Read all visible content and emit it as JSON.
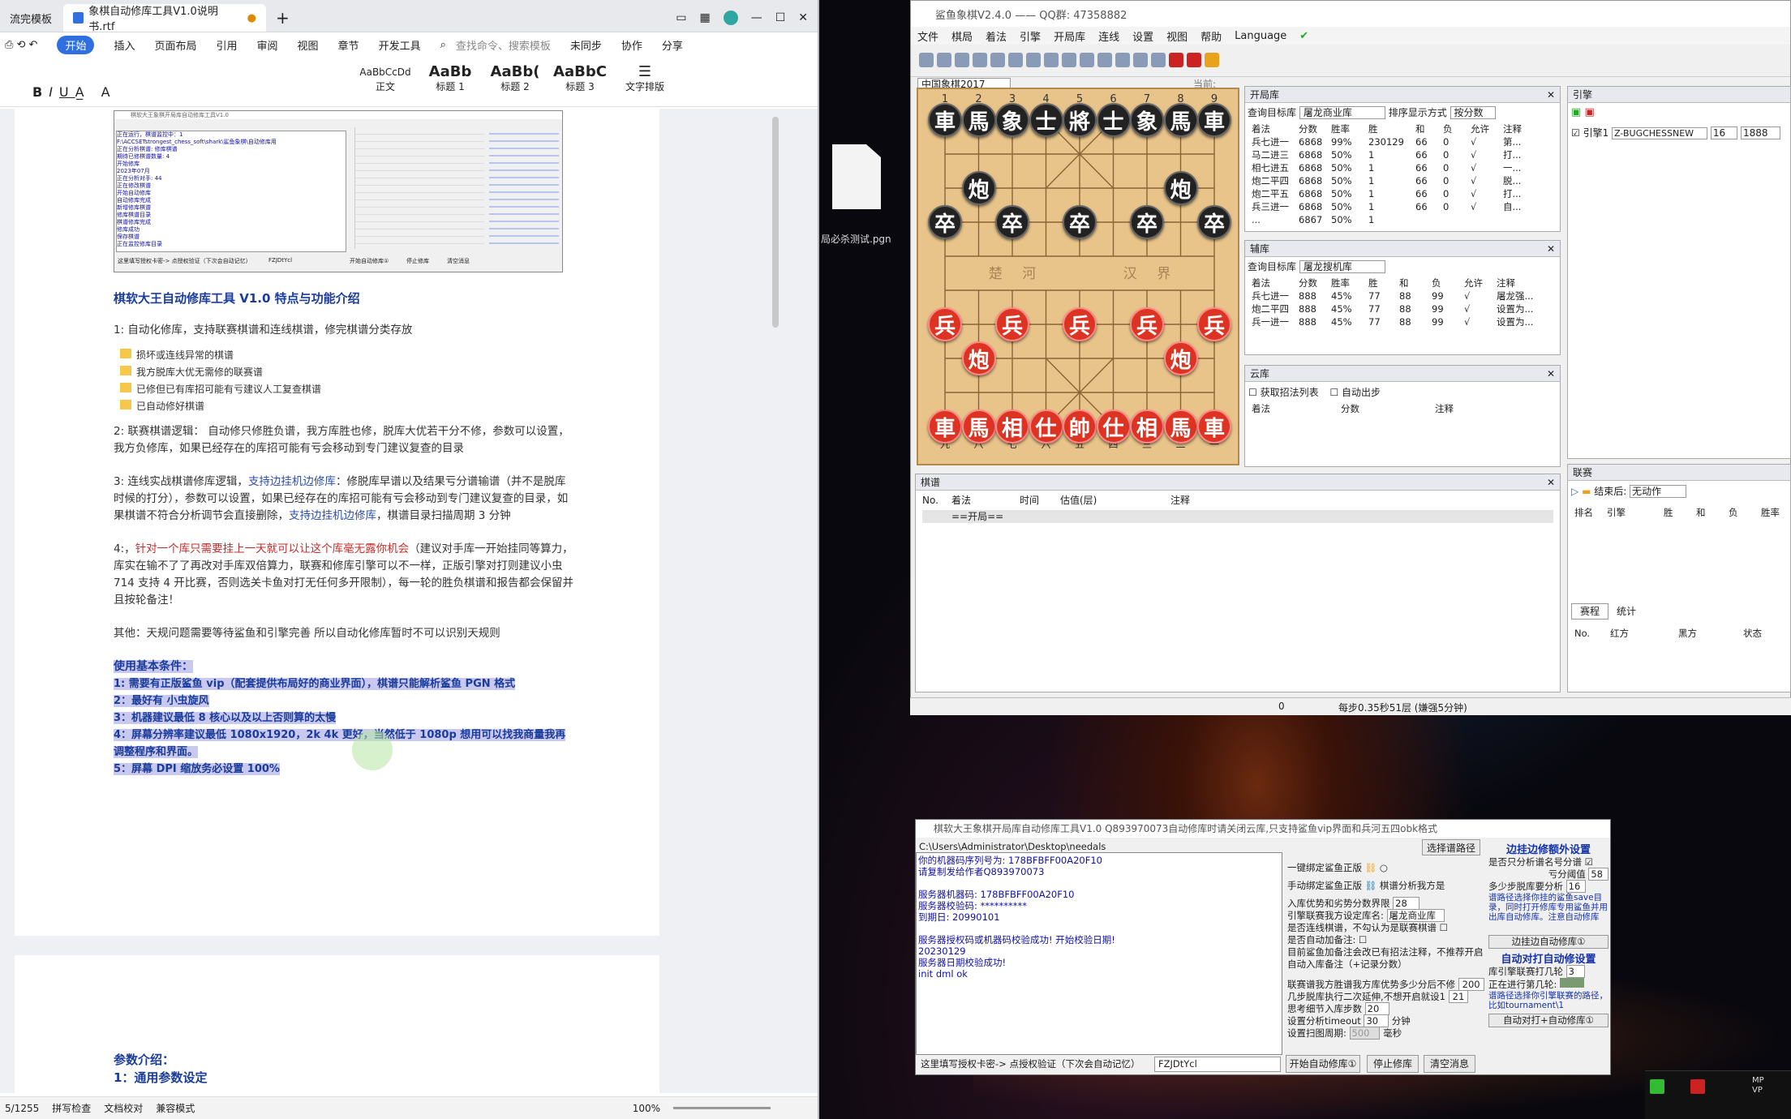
{
  "wps": {
    "tab1": "流完模板",
    "tab2": "象棋自动修库工具V1.0说明书.rtf",
    "menu": [
      "开始",
      "插入",
      "页面布局",
      "引用",
      "审阅",
      "视图",
      "章节",
      "开发工具"
    ],
    "search": "查找命令、搜索模板",
    "sync": "未同步",
    "collab": "协作",
    "share": "分享",
    "styles": [
      {
        "s": "AaBbCcDd",
        "n": "正文"
      },
      {
        "s": "AaBb",
        "n": "标题 1"
      },
      {
        "s": "AaBb(",
        "n": "标题 2"
      },
      {
        "s": "AaBbC",
        "n": "标题 3"
      }
    ],
    "layout": "文字排版",
    "heading": "棋软大王自动修库工具 V1.0 特点与功能介绍",
    "p1": "1: 自动化修库，支持联赛棋谱和连线棋谱，修完棋谱分类存放",
    "folders": [
      "损坏或连线异常的棋谱",
      "我方脱库大优无需修的联赛谱",
      "已修但已有库招可能有亏建议人工复查棋谱",
      "已自动修好棋谱"
    ],
    "p2": "2: 联赛棋谱逻辑：  自动修只修胜负谱，我方库胜也修，脱库大优若干分不修，参数可以设置，我方负修库，如果已经存在的库招可能有亏会移动到专门建议复查的目录",
    "p3a": "3: 连线实战棋谱修库逻辑，",
    "p3b": "支持边挂机边修库",
    "p3c": "：修脱库早谱以及结果亏分谱输谱（并不是脱库时候的打分），参数可以设置，如果已经存在的库招可能有亏会移动到专门建议复查的目录，如果棋谱不符合分析调节会直接删除，",
    "p3d": "支持边挂机边修库",
    "p3e": "，棋谱目录扫描周期 3 分钟",
    "p4a": "4:，",
    "p4b": "针对一个库只需要挂上一天就可以让这个库毫无露你机会",
    "p4c": "（建议对手库一开始挂同等算力，库实在输不了了再改对手库双倍算力，联赛和修库引擎可以不一样，正版引擎对打则建议小虫 714 支持 4 开比赛，否则选关卡鱼对打无任何多开限制），每一轮的胜负棋谱和报告都会保留并且按轮备注！",
    "p5": "其他：天规问题需要等待鲨鱼和引擎完善  所以自动化修库暂时不可以识别天规则",
    "cond": [
      "使用基本条件：",
      "1: 需要有正版鲨鱼 vip（配套提供布局好的商业界面），棋谱只能解析鲨鱼 PGN 格式",
      "2：最好有  小虫旋风",
      "3：机器建议最低 8 核心以及以上否则算的太慢",
      "4：屏幕分辨率建议最低 1080x1920，2k 4k 更好，当然低于 1080p 想用可以找我商量我再调整程序和界面。",
      "5：屏幕 DPI 缩放务必设置 100%"
    ],
    "p2title": "参数介绍：",
    "p2sub": "1：通用参数设定",
    "status": {
      "page": "5/1255",
      "spell": "拼写检查",
      "proof": "文档校对",
      "compat": "兼容模式",
      "zoom": "100%"
    },
    "thumb": {
      "title": "棋软大王象棋开局库自动修库工具V1.0",
      "lines": [
        "正在运行，棋谱监控中：1",
        "F:\\ACCSETstrongest_chess_soft\\shark\\鲨鱼象棋\\自动修库用",
        "正在分析棋谱: 修库棋谱",
        "期待已修棋谱数量: 4",
        "开始修库",
        "2023年07月",
        "正在分析对手: 44",
        "正在修改棋谱",
        "开始自动修库",
        "自动修库完成",
        "新增修库棋谱",
        "修库棋谱目录",
        "棋谱修库完成",
        "修库成功",
        "保存棋谱",
        "正在监控修库目录"
      ],
      "bottom": "这里填写授权卡密-> 点授权验证（下次会自动记忆）",
      "code": "FZJDtYcl",
      "btns": [
        "开始自动修库①",
        "停止修库",
        "清空消息"
      ]
    }
  },
  "desktop": {
    "file_label": "局必杀测试.pgn"
  },
  "shark": {
    "title": "鲨鱼象棋V2.4.0 ——  QQ群: 47358882",
    "menu": [
      "文件",
      "棋局",
      "着法",
      "引擎",
      "开局库",
      "连线",
      "设置",
      "视图",
      "帮助",
      "Language"
    ],
    "preset": "中国象棋2017",
    "input_label": "当前:",
    "files_top": [
      "1",
      "2",
      "3",
      "4",
      "5",
      "6",
      "7",
      "8",
      "9"
    ],
    "files_bottom": [
      "九",
      "八",
      "七",
      "六",
      "五",
      "四",
      "三",
      "二",
      "一"
    ],
    "river": [
      "楚",
      "河",
      "汉",
      "界"
    ],
    "pieces": [
      {
        "c": "b",
        "t": "車",
        "f": 0,
        "r": 0
      },
      {
        "c": "b",
        "t": "馬",
        "f": 1,
        "r": 0
      },
      {
        "c": "b",
        "t": "象",
        "f": 2,
        "r": 0
      },
      {
        "c": "b",
        "t": "士",
        "f": 3,
        "r": 0
      },
      {
        "c": "b",
        "t": "將",
        "f": 4,
        "r": 0
      },
      {
        "c": "b",
        "t": "士",
        "f": 5,
        "r": 0
      },
      {
        "c": "b",
        "t": "象",
        "f": 6,
        "r": 0
      },
      {
        "c": "b",
        "t": "馬",
        "f": 7,
        "r": 0
      },
      {
        "c": "b",
        "t": "車",
        "f": 8,
        "r": 0
      },
      {
        "c": "b",
        "t": "炮",
        "f": 1,
        "r": 2
      },
      {
        "c": "b",
        "t": "炮",
        "f": 7,
        "r": 2
      },
      {
        "c": "b",
        "t": "卒",
        "f": 0,
        "r": 3
      },
      {
        "c": "b",
        "t": "卒",
        "f": 2,
        "r": 3
      },
      {
        "c": "b",
        "t": "卒",
        "f": 4,
        "r": 3
      },
      {
        "c": "b",
        "t": "卒",
        "f": 6,
        "r": 3
      },
      {
        "c": "b",
        "t": "卒",
        "f": 8,
        "r": 3
      },
      {
        "c": "r",
        "t": "兵",
        "f": 0,
        "r": 6
      },
      {
        "c": "r",
        "t": "兵",
        "f": 2,
        "r": 6
      },
      {
        "c": "r",
        "t": "兵",
        "f": 4,
        "r": 6
      },
      {
        "c": "r",
        "t": "兵",
        "f": 6,
        "r": 6
      },
      {
        "c": "r",
        "t": "兵",
        "f": 8,
        "r": 6
      },
      {
        "c": "r",
        "t": "炮",
        "f": 1,
        "r": 7
      },
      {
        "c": "r",
        "t": "炮",
        "f": 7,
        "r": 7
      },
      {
        "c": "r",
        "t": "車",
        "f": 0,
        "r": 9
      },
      {
        "c": "r",
        "t": "馬",
        "f": 1,
        "r": 9
      },
      {
        "c": "r",
        "t": "相",
        "f": 2,
        "r": 9
      },
      {
        "c": "r",
        "t": "仕",
        "f": 3,
        "r": 9
      },
      {
        "c": "r",
        "t": "帥",
        "f": 4,
        "r": 9
      },
      {
        "c": "r",
        "t": "仕",
        "f": 5,
        "r": 9
      },
      {
        "c": "r",
        "t": "相",
        "f": 6,
        "r": 9
      },
      {
        "c": "r",
        "t": "馬",
        "f": 7,
        "r": 9
      },
      {
        "c": "r",
        "t": "車",
        "f": 8,
        "r": 9
      }
    ],
    "openbook": {
      "title": "开局库",
      "target_label": "查询目标库",
      "target": "屠龙商业库",
      "sort_label": "排序显示方式",
      "sort": "按分数",
      "cols": [
        "着法",
        "分数",
        "胜率",
        "胜",
        "和",
        "负",
        "允许",
        "注释"
      ],
      "rows": [
        [
          "兵七进一",
          "6868",
          "99%",
          "230129",
          "66",
          "0",
          "√",
          "第..."
        ],
        [
          "马二进三",
          "6868",
          "50%",
          "1",
          "66",
          "0",
          "√",
          "打..."
        ],
        [
          "相七进五",
          "6868",
          "50%",
          "1",
          "66",
          "0",
          "√",
          "一..."
        ],
        [
          "炮二平四",
          "6868",
          "50%",
          "1",
          "66",
          "0",
          "√",
          "脱..."
        ],
        [
          "炮二平五",
          "6868",
          "50%",
          "1",
          "66",
          "0",
          "√",
          "打..."
        ],
        [
          "兵三进一",
          "6868",
          "50%",
          "1",
          "66",
          "0",
          "√",
          "自..."
        ],
        [
          "...",
          "6867",
          "50%",
          "1",
          "",
          "",
          "",
          ""
        ]
      ]
    },
    "subbook": {
      "title": "辅库",
      "target_label": "查询目标库",
      "target": "屠龙搜机库",
      "cols": [
        "着法",
        "分数",
        "胜率",
        "胜",
        "和",
        "负",
        "允许",
        "注释"
      ],
      "rows": [
        [
          "兵七进一",
          "888",
          "45%",
          "77",
          "88",
          "99",
          "√",
          "屠龙强..."
        ],
        [
          "炮二平四",
          "888",
          "45%",
          "77",
          "88",
          "99",
          "√",
          "设置为..."
        ],
        [
          "兵一进一",
          "888",
          "45%",
          "77",
          "88",
          "99",
          "√",
          "设置为..."
        ]
      ]
    },
    "cloud": {
      "title": "云库",
      "c1": "获取招法列表",
      "c2": "自动出步",
      "cols": [
        "着法",
        "分数",
        "注释"
      ]
    },
    "record": {
      "title": "棋谱",
      "cols": [
        "No.",
        "着法",
        "时间",
        "估值(层)",
        "注释"
      ],
      "first": "==开局=="
    },
    "engine": {
      "title": "引擎",
      "label": "引擎1",
      "name": "Z-BUGCHESSNEW",
      "threads": "16",
      "hash": "1888"
    },
    "league": {
      "title": "联赛",
      "end_label": "结束后:",
      "end": "无动作",
      "cols": [
        "排名",
        "引擎",
        "胜",
        "和",
        "负",
        "胜率"
      ],
      "tab1": "赛程",
      "tab2": "统计",
      "cols2": [
        "No.",
        "红方",
        "黑方",
        "状态"
      ]
    },
    "status": {
      "a": "0",
      "b": "每步0.35秒51层 (嫌强5分钟)"
    }
  },
  "tool": {
    "title": "棋软大王象棋开局库自动修库工具V1.0  Q893970073自动修库时请关闭云库,只支持鲨鱼vip界面和兵河五四obk格式",
    "path": "C:\\Users\\Administrator\\Desktop\\needals",
    "pick": "选择谱路径",
    "log": "你的机器码序列号为: 178BFBFF00A20F10\n请复制发给作者Q893970073\n\n服务器机器码: 178BFBFF00A20F10\n服务器校验码: **********\n到期日: 20990101\n\n服务器授权码或机器码校验成功! 开始校验日期!\n20230129\n服务器日期校验成功!\ninit dml ok",
    "bind1": "一键绑定鲨鱼正版",
    "bind2": "手动绑定鲨鱼正版",
    "analysis": "棋谱分析我方是",
    "l1": "入库优势和劣势分数界限",
    "v1": "28",
    "l2": "引擎联赛我方设定库名:",
    "v2": "屠龙商业库",
    "l3": "是否连线棋谱，不勾认为是联赛棋谱",
    "l4": "是否自动加备注:",
    "l5": "目前鲨鱼加备注会改已有招法注释，不推荐开启",
    "l6": "自动入库备注（+记录分数）",
    "l7": "联赛谱我方胜谱我方库优势多少分后不修",
    "v7": "200",
    "l8": "几步脱库执行二次延伸,不想开启就设1",
    "v8": "21",
    "l9": "思考细节入库步数",
    "v9": "20",
    "l10": "设置分析timeout",
    "v10": "30",
    "u10": "分钟",
    "l11": "设置扫图周期:",
    "v11": "500",
    "u11": "毫秒",
    "h1": "边挂边修额外设置",
    "r1": "是否只分析谱名号分谱",
    "r2": "亏分阈值",
    "rv2": "58",
    "r3": "多少步脱库要分析",
    "rv3": "16",
    "note1": "谱路径选择你挂的鲨鱼save目录，同时打开修库专用鲨鱼并用出库自动修库。注意自动修库",
    "bb1": "边挂边自动修库①",
    "h2": "自动对打自动修设置",
    "r4": "库引擎联赛打几轮",
    "rv4": "3",
    "r5": "正在进行第几轮:",
    "note2": "谱路径选择你引擎联赛的路径，比如tournament\\1",
    "bb2": "自动对打+自动修库①",
    "bottom": "这里填写授权卡密-> 点授权验证（下次会自动记忆）",
    "code": "FZJDtYcl",
    "btns": [
      "开始自动修库①",
      "停止修库",
      "清空消息"
    ]
  },
  "player": {
    "label": "MP VP"
  }
}
